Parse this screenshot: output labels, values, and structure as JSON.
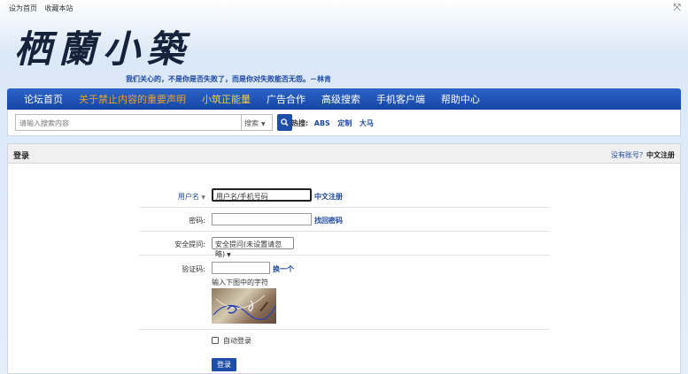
{
  "topbar": {
    "set_home": "设为首页",
    "bookmark": "收藏本站"
  },
  "logo": {
    "text": "栖蘭小築"
  },
  "motto": "我们关心的，不是你是否失败了，而是你对失败能否无怨。－林肯",
  "nav": {
    "items": [
      {
        "label": "论坛首页"
      },
      {
        "label": "关于禁止内容的重要声明"
      },
      {
        "label": "小筑正能量"
      },
      {
        "label": "广告合作"
      },
      {
        "label": "高级搜索"
      },
      {
        "label": "手机客户端"
      },
      {
        "label": "帮助中心"
      }
    ]
  },
  "search": {
    "placeholder": "请输入搜索内容",
    "type_label": "搜索",
    "hot_label": "热搜:",
    "hot_tags": [
      "ABS",
      "定制",
      "大马"
    ]
  },
  "login": {
    "title": "登录",
    "no_account": "没有账号？",
    "register_cn": "中文注册",
    "username_label": "用户名",
    "username_placeholder": "用户名/手机号码",
    "username_register": "中文注册",
    "password_label": "密码:",
    "find_password": "找回密码",
    "security_label": "安全提问:",
    "security_value": "安全提问(未设置请忽略)",
    "captcha_label": "验证码:",
    "captcha_change": "换一个",
    "captcha_hint": "输入下图中的字符",
    "auto_login": "自动登录",
    "submit": "登录"
  },
  "colors": {
    "nav_bg": "#1e4ea8",
    "link_blue": "#1c47a0",
    "nav_orange": "#e8a031",
    "nav_yellow": "#f3d13c"
  },
  "icons": {
    "expand": "expand-arrows-icon",
    "search": "magnifier-icon",
    "dropdown": "caret-down-icon"
  }
}
